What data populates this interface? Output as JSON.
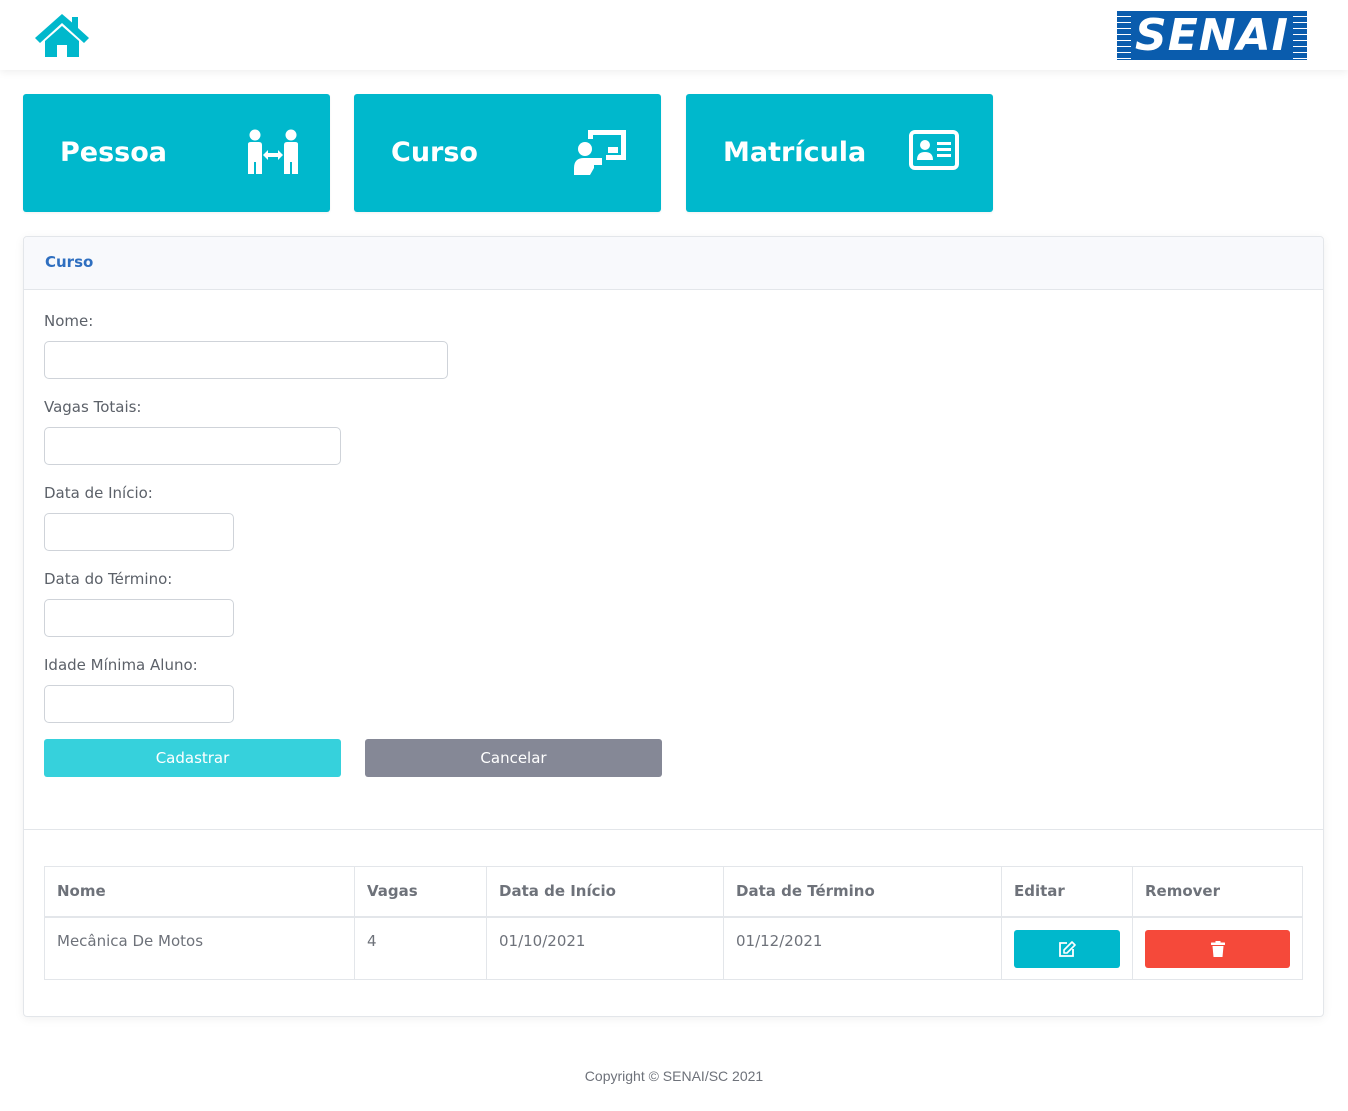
{
  "colors": {
    "accent": "#00b8cc",
    "brand_blue": "#0a5cad",
    "primary_button": "#36d1dc",
    "secondary_button": "#858896",
    "danger": "#f5493a",
    "panel_title": "#2f6fc0"
  },
  "header": {
    "home_icon": "house-icon",
    "logo_text": "SENAI"
  },
  "nav": {
    "cards": [
      {
        "label": "Pessoa",
        "icon": "people-exchange-icon"
      },
      {
        "label": "Curso",
        "icon": "teacher-board-icon"
      },
      {
        "label": "Matrícula",
        "icon": "id-card-icon"
      }
    ]
  },
  "form": {
    "title": "Curso",
    "fields": {
      "nome": {
        "label": "Nome:",
        "value": ""
      },
      "vagas": {
        "label": "Vagas Totais:",
        "value": ""
      },
      "inicio": {
        "label": "Data de Início:",
        "value": ""
      },
      "termino": {
        "label": "Data do Término:",
        "value": ""
      },
      "idade": {
        "label": "Idade Mínima Aluno:",
        "value": ""
      }
    },
    "submit_label": "Cadastrar",
    "cancel_label": "Cancelar"
  },
  "table": {
    "headers": [
      "Nome",
      "Vagas",
      "Data de Início",
      "Data de Término",
      "Editar",
      "Remover"
    ],
    "rows": [
      {
        "nome": "Mecânica De Motos",
        "vagas": "4",
        "inicio": "01/10/2021",
        "termino": "01/12/2021",
        "edit_icon": "edit-icon",
        "remove_icon": "trash-icon"
      }
    ]
  },
  "footer": {
    "copyright": "Copyright © SENAI/SC 2021"
  }
}
